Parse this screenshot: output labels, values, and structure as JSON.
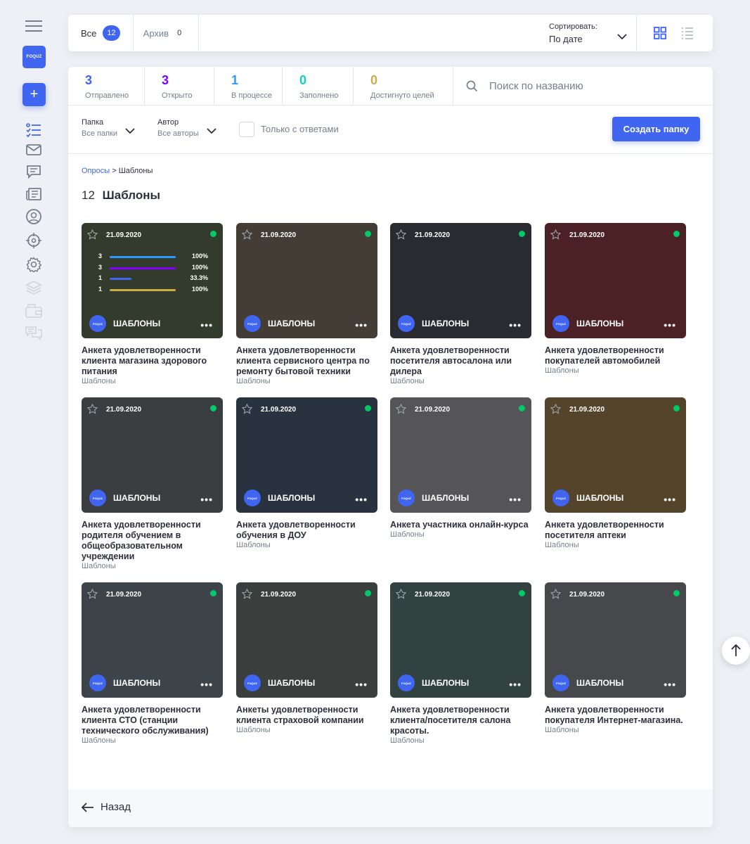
{
  "sidebar": {
    "logo_text": "FOQUZ",
    "add_label": "+",
    "icons": [
      "list-check-icon",
      "mail-icon",
      "comment-list-icon",
      "news-icon",
      "user-circle-icon",
      "target-icon",
      "gear-icon",
      "layers-icon",
      "wallet-icon",
      "chat-list-icon"
    ]
  },
  "tabs": {
    "all_label": "Все",
    "all_count": "12",
    "archive_label": "Архив",
    "archive_count": "0"
  },
  "sort": {
    "label": "Сортировать:",
    "value": "По дате"
  },
  "stats": [
    {
      "value": "3",
      "label": "Отправлено",
      "color": "#3f65f1"
    },
    {
      "value": "3",
      "label": "Открыто",
      "color": "#8400ff"
    },
    {
      "value": "1",
      "label": "В процессе",
      "color": "#2d99ff"
    },
    {
      "value": "0",
      "label": "Заполнено",
      "color": "#16ceb9"
    },
    {
      "value": "0",
      "label": "Достигнуто целей",
      "color": "#caad46"
    }
  ],
  "search": {
    "placeholder": "Поиск по названию"
  },
  "filters": {
    "folder_label": "Папка",
    "folder_value": "Все папки",
    "author_label": "Автор",
    "author_value": "Все авторы",
    "only_answers": "Только с ответами",
    "create_button": "Создать папку"
  },
  "breadcrumb": {
    "root": "Опросы",
    "sep": " > ",
    "current": "Шаблоны"
  },
  "section": {
    "count": "12",
    "title": "Шаблоны"
  },
  "card_common": {
    "date": "21.09.2020",
    "folder": "ШАБЛОНЫ",
    "logo": "FOQUZ",
    "more": "•••",
    "sub": "Шаблоны"
  },
  "stats_preview": [
    {
      "q": "3",
      "pct": "100%",
      "fill": 1.0,
      "color": "#2d99ff"
    },
    {
      "q": "3",
      "pct": "100%",
      "fill": 1.0,
      "color": "#8400ff"
    },
    {
      "q": "1",
      "pct": "33.3%",
      "fill": 0.333,
      "color": "#3f65f1"
    },
    {
      "q": "1",
      "pct": "100%",
      "fill": 1.0,
      "color": "#caad46"
    }
  ],
  "cards": [
    {
      "name": "Анкета удовлетворенности клиента магазина здорового питания",
      "bg": "#4d5a3a"
    },
    {
      "name": "Анкета удовлетворенности клиента сервисного центра по ремонту бытовой техники",
      "bg": "#6b5d4c"
    },
    {
      "name": "Анкета удовлетворенности посетителя автосалона или дилера",
      "bg": "#3c3d40"
    },
    {
      "name": "Анкета удовлетворенности покупателей автомобилей",
      "bg": "#7a2a2e"
    },
    {
      "name": "Анкета удовлетворенности родителя обучением в общеобразовательном учреждении",
      "bg": "#5b5f60"
    },
    {
      "name": "Анкета удовлетворенности обучения в ДОУ",
      "bg": "#3b4b5e"
    },
    {
      "name": "Анкета участника онлайн-курса",
      "bg": "#8a8886"
    },
    {
      "name": "Анкета удовлетворенности посетителя аптеки",
      "bg": "#8a6a3a"
    },
    {
      "name": "Анкета удовлетворенности клиента СТО (станции технического обслуживания)",
      "bg": "#5d6a70"
    },
    {
      "name": "Анкеты удовлетворенности клиента страховой компании",
      "bg": "#596058"
    },
    {
      "name": "Анкета удовлетворенности клиента/посетителя салона красоты.",
      "bg": "#4a6660"
    },
    {
      "name": "Анкета удовлетворенности покупателя Интернет-магазина.",
      "bg": "#707274"
    }
  ],
  "footer": {
    "back_label": "Назад"
  }
}
